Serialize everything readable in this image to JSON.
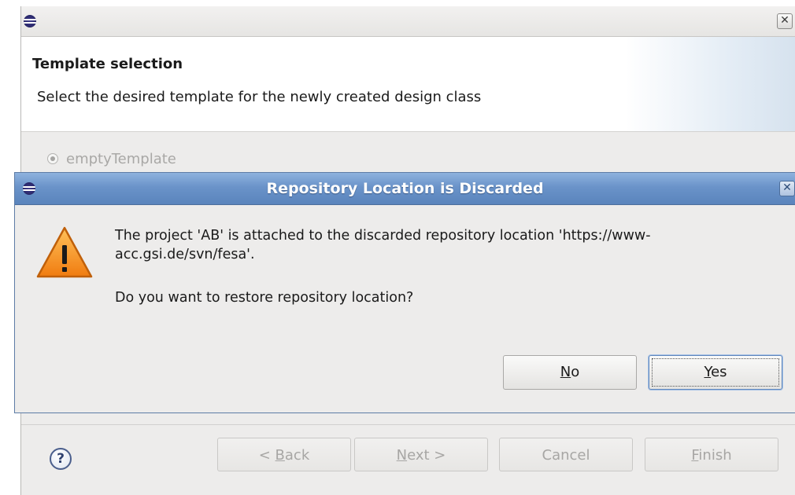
{
  "wizard": {
    "header_title": "Template selection",
    "header_description": "Select the desired template for the newly created design class",
    "radio_option_label": "emptyTemplate",
    "close_glyph": "✕",
    "icons": [
      "eclipse-icon",
      "close-icon",
      "help-icon"
    ],
    "buttons": {
      "back": {
        "prefix": "< ",
        "mnemonic": "B",
        "rest": "ack"
      },
      "next": {
        "prefix": "",
        "mnemonic": "N",
        "rest": "ext >"
      },
      "cancel": {
        "label": "Cancel"
      },
      "finish": {
        "prefix": "",
        "mnemonic": "F",
        "rest": "inish"
      }
    },
    "help_glyph": "?"
  },
  "dialog": {
    "title": "Repository Location is Discarded",
    "message": "The project 'AB' is attached to the discarded repository location 'https://www-acc.gsi.de/svn/fesa'.",
    "question": "Do you want to restore repository location?",
    "icons": [
      "eclipse-icon",
      "close-icon",
      "warning-icon"
    ],
    "buttons": {
      "no": {
        "mnemonic": "N",
        "rest": "o"
      },
      "yes": {
        "mnemonic": "Y",
        "rest": "es"
      }
    },
    "colors": {
      "titlebar": "#6a93c9",
      "warning": "#f7931e"
    }
  }
}
